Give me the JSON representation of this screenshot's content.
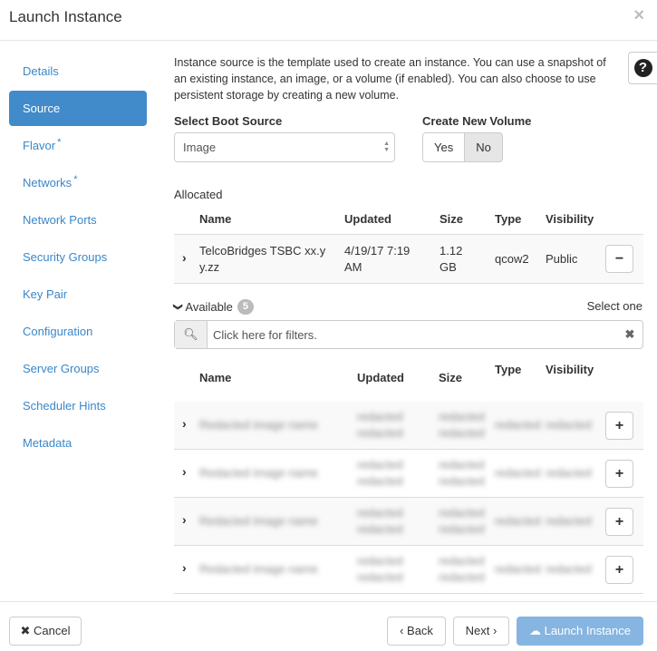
{
  "header": {
    "title": "Launch Instance",
    "close_icon": "×"
  },
  "sidebar": {
    "items": [
      {
        "label": "Details",
        "required": false,
        "active": false
      },
      {
        "label": "Source",
        "required": false,
        "active": true
      },
      {
        "label": "Flavor",
        "required": true,
        "active": false
      },
      {
        "label": "Networks",
        "required": true,
        "active": false
      },
      {
        "label": "Network Ports",
        "required": false,
        "active": false
      },
      {
        "label": "Security Groups",
        "required": false,
        "active": false
      },
      {
        "label": "Key Pair",
        "required": false,
        "active": false
      },
      {
        "label": "Configuration",
        "required": false,
        "active": false
      },
      {
        "label": "Server Groups",
        "required": false,
        "active": false
      },
      {
        "label": "Scheduler Hints",
        "required": false,
        "active": false
      },
      {
        "label": "Metadata",
        "required": false,
        "active": false
      }
    ],
    "required_marker": "*"
  },
  "main": {
    "description": "Instance source is the template used to create an instance. You can use a snapshot of an existing instance, an image, or a volume (if enabled). You can also choose to use persistent storage by creating a new volume.",
    "help_icon": "?",
    "boot_source": {
      "label": "Select Boot Source",
      "value": "Image"
    },
    "new_volume": {
      "label": "Create New Volume",
      "yes": "Yes",
      "no": "No",
      "selected": "No"
    },
    "allocated": {
      "label": "Allocated",
      "columns": [
        "Name",
        "Updated",
        "Size",
        "Type",
        "Visibility"
      ],
      "rows": [
        {
          "name_line1": "TelcoBridges TSBC xx.y",
          "name_line2": "y.zz",
          "updated_line1": "4/19/17 7:19",
          "updated_line2": "AM",
          "size_line1": "1.12",
          "size_line2": "GB",
          "type": "qcow2",
          "visibility": "Public",
          "action": "−"
        }
      ]
    },
    "available": {
      "label": "Available",
      "count": "5",
      "select_hint": "Select one",
      "filter_placeholder": "Click here for filters.",
      "columns": [
        "Name",
        "Updated",
        "Size",
        "Type",
        "Visibility"
      ],
      "rows": [
        {
          "name": "Redacted image name",
          "updated_line1": "redacted",
          "updated_line2": "redacted",
          "size_line1": "redacted",
          "size_line2": "redacted",
          "type": "redacted",
          "visibility": "redacted",
          "action": "+"
        },
        {
          "name": "Redacted image name",
          "updated_line1": "redacted",
          "updated_line2": "redacted",
          "size_line1": "redacted",
          "size_line2": "redacted",
          "type": "redacted",
          "visibility": "redacted",
          "action": "+"
        },
        {
          "name": "Redacted image name",
          "updated_line1": "redacted",
          "updated_line2": "redacted",
          "size_line1": "redacted",
          "size_line2": "redacted",
          "type": "redacted",
          "visibility": "redacted",
          "action": "+"
        },
        {
          "name": "Redacted image name",
          "updated_line1": "redacted",
          "updated_line2": "redacted",
          "size_line1": "redacted",
          "size_line2": "redacted",
          "type": "redacted",
          "visibility": "redacted",
          "action": "+"
        }
      ]
    }
  },
  "footer": {
    "cancel": "✖ Cancel",
    "back": "‹ Back",
    "next": "Next ›",
    "launch": "☁ Launch Instance"
  },
  "colors": {
    "accent": "#428bca",
    "link": "#3a87c8",
    "launch_disabled": "#85b5e0"
  }
}
